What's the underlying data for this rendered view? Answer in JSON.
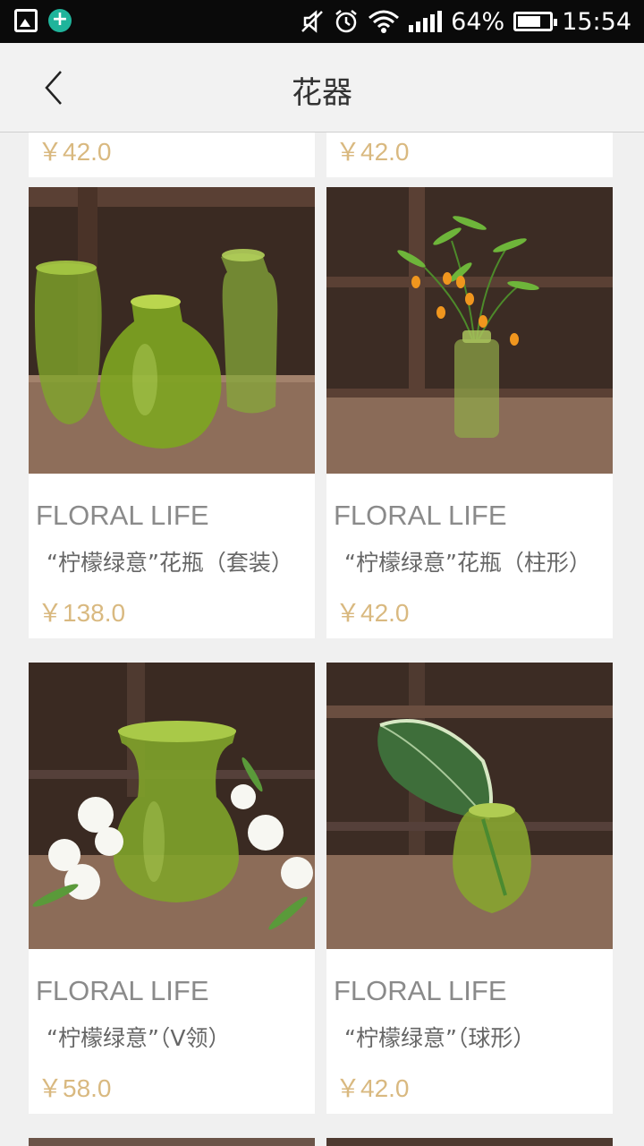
{
  "status_bar": {
    "battery_percent": "64%",
    "battery_level": 0.64,
    "time": "15:54",
    "icons": [
      "gallery-icon",
      "add-icon",
      "mute-icon",
      "alarm-icon",
      "wifi-icon",
      "signal-icon",
      "battery-icon"
    ]
  },
  "header": {
    "title": "花器",
    "back_icon": "chevron-left-icon"
  },
  "partial_row": {
    "left_price": "￥42.0",
    "right_price": "￥42.0"
  },
  "products": [
    {
      "brand": "FLORAL LIFE",
      "name": "“柠檬绿意”花瓶（套装）",
      "price": "￥138.0",
      "image": "three-green-glass-vases"
    },
    {
      "brand": "FLORAL LIFE",
      "name": "“柠檬绿意”花瓶（柱形）",
      "price": "￥42.0",
      "image": "column-vase-with-orange-flowers"
    },
    {
      "brand": "FLORAL LIFE",
      "name": "“柠檬绿意”（V领）",
      "price": "￥58.0",
      "image": "v-neck-vase-with-white-lilies"
    },
    {
      "brand": "FLORAL LIFE",
      "name": "“柠檬绿意”（球形）",
      "price": "￥42.0",
      "image": "round-vase-with-hosta-leaf"
    }
  ],
  "colors": {
    "price": "#d9b980",
    "status_bar_bg": "#0a0a0a",
    "header_bg": "#f2f2f2",
    "page_bg": "#f0f0f0"
  }
}
